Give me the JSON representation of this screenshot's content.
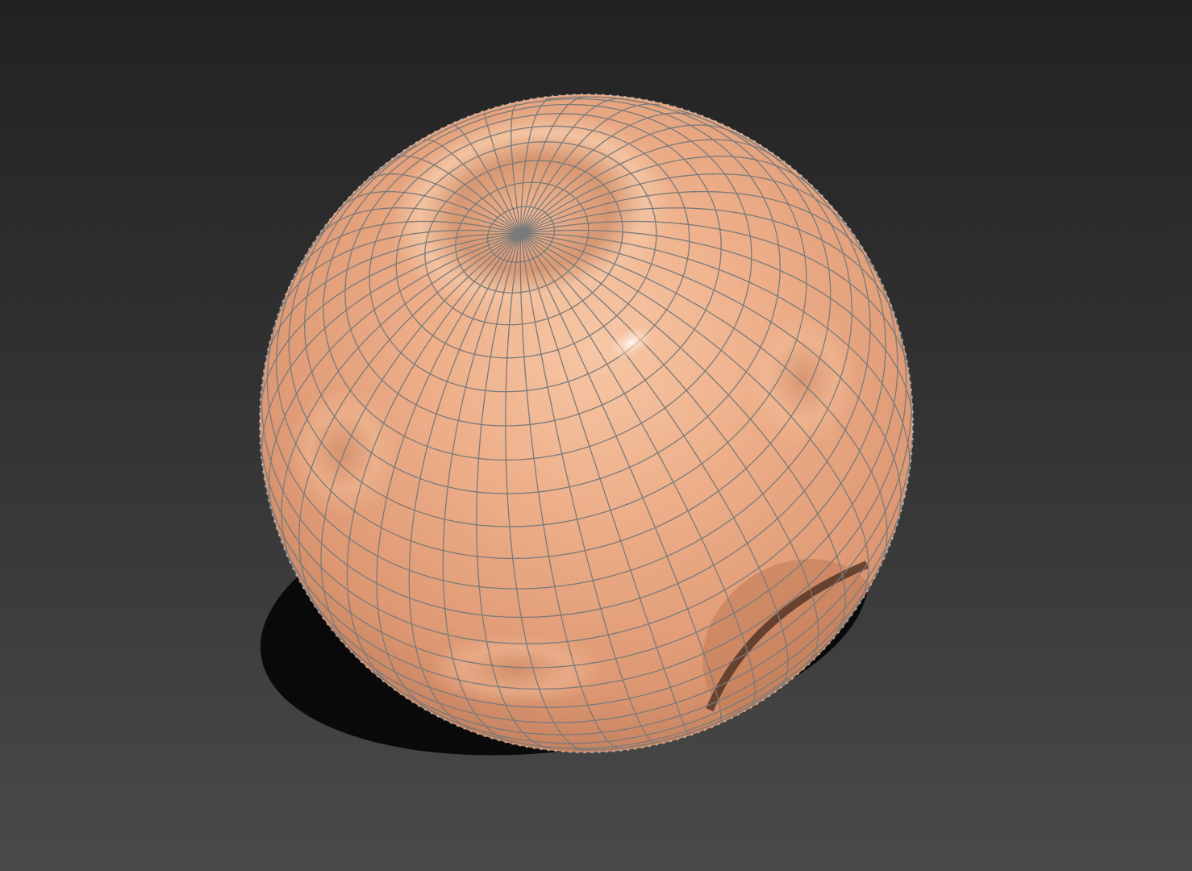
{
  "viewport": {
    "background_top": "#232323",
    "background_bottom": "#4a4a4a",
    "shading_mode": "smooth-shaded-with-wireframe"
  },
  "model": {
    "kind": "sculpted-sphere",
    "surface_color": "#e8a680",
    "highlight_color": "#fbd6bc",
    "shadow_color": "#8f5a3e",
    "wireframe_color": "#7a7a7a",
    "silhouette_wire_color": "#d8d8d8",
    "dents": 5
  }
}
